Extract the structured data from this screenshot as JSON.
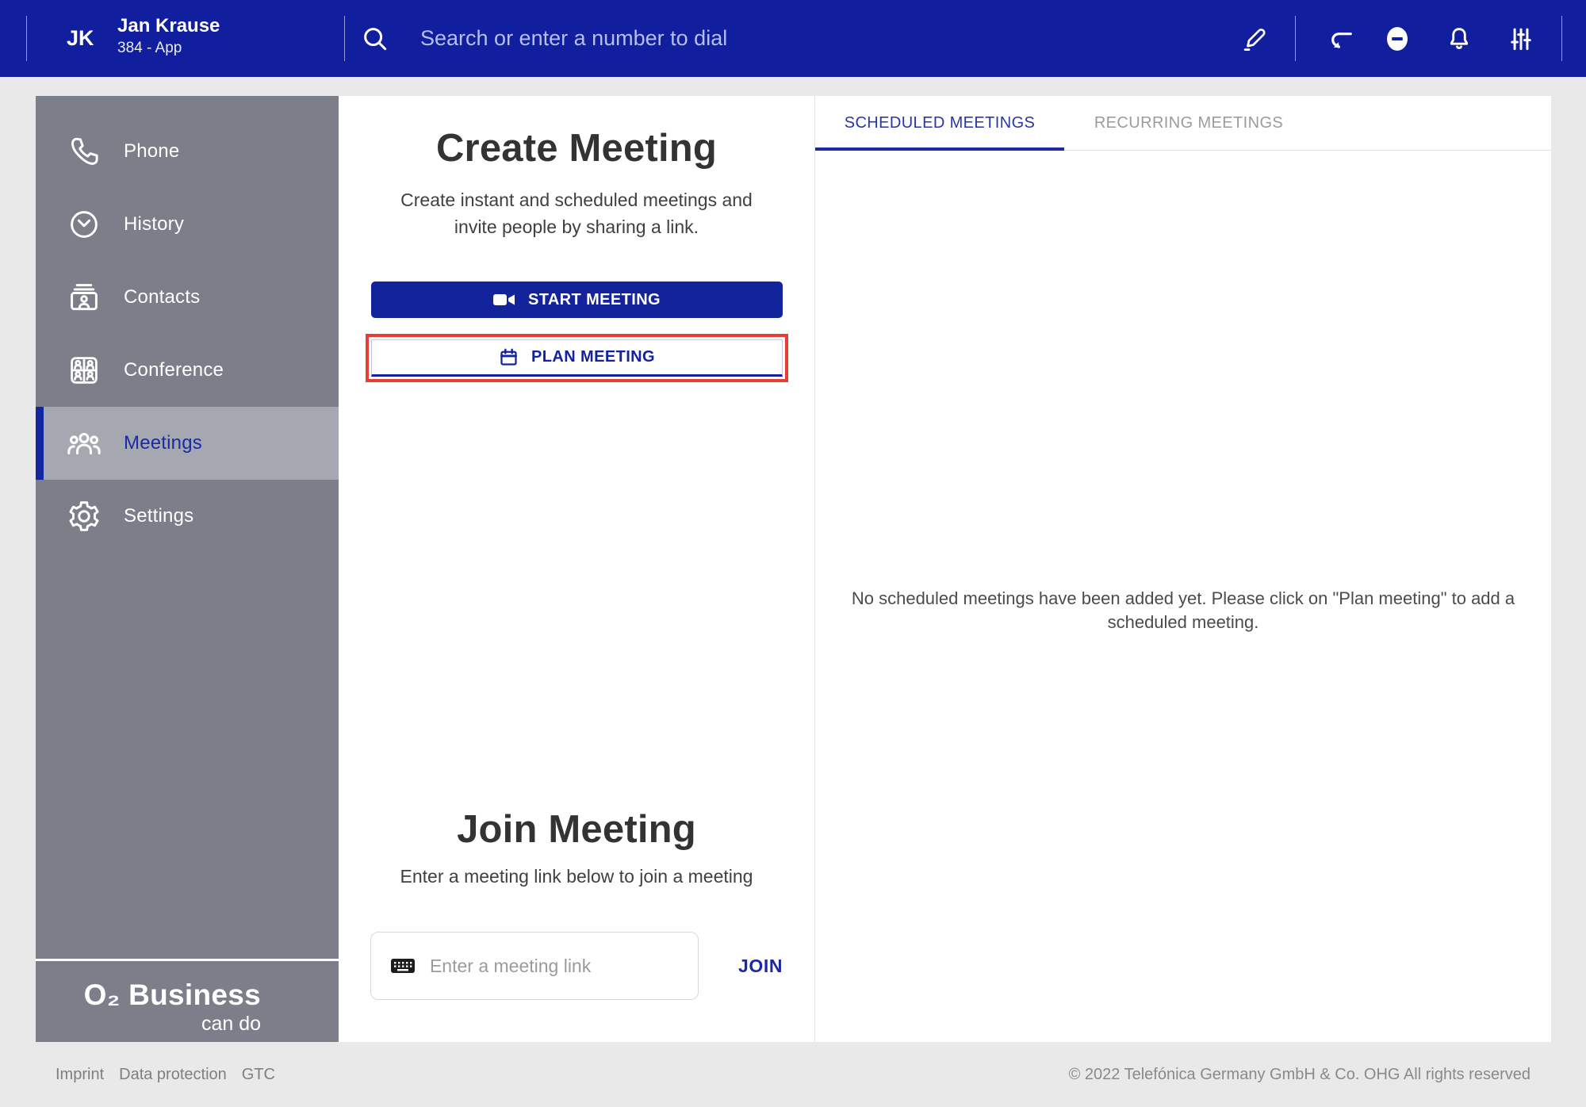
{
  "topbar": {
    "avatar_initials": "JK",
    "user_name": "Jan Krause",
    "user_extension": "384 - App",
    "search_placeholder": "Search or enter a number to dial",
    "icons": [
      "search-icon",
      "pencil-icon",
      "call-pull-icon",
      "do-not-disturb-icon",
      "bell-icon",
      "sliders-icon"
    ]
  },
  "sidebar": {
    "items": [
      {
        "label": "Phone",
        "icon": "phone-icon",
        "active": false
      },
      {
        "label": "History",
        "icon": "history-icon",
        "active": false
      },
      {
        "label": "Contacts",
        "icon": "contacts-icon",
        "active": false
      },
      {
        "label": "Conference",
        "icon": "conference-icon",
        "active": false
      },
      {
        "label": "Meetings",
        "icon": "meetings-icon",
        "active": true
      },
      {
        "label": "Settings",
        "icon": "settings-icon",
        "active": false
      }
    ],
    "logo_main": "O₂ Business",
    "logo_sub": "can do"
  },
  "create_meeting": {
    "title": "Create Meeting",
    "description": "Create instant and scheduled meetings and invite people by sharing a link.",
    "start_button": "START MEETING",
    "plan_button": "PLAN MEETING"
  },
  "join_meeting": {
    "title": "Join Meeting",
    "description": "Enter a meeting link below to join a meeting",
    "input_placeholder": "Enter a meeting link",
    "join_button": "JOIN"
  },
  "meetings_panel": {
    "tabs": [
      {
        "label": "SCHEDULED MEETINGS",
        "active": true
      },
      {
        "label": "RECURRING MEETINGS",
        "active": false
      }
    ],
    "empty_message": "No scheduled meetings have been added yet. Please click on \"Plan meeting\" to add a scheduled meeting."
  },
  "footer": {
    "links": [
      "Imprint",
      "Data protection",
      "GTC"
    ],
    "copyright": "© 2022 Telefónica Germany GmbH & Co. OHG All rights reserved"
  },
  "colors": {
    "brand_blue": "#111f9e",
    "button_blue": "#13239c",
    "accent_blue": "#1b2aa0",
    "highlight_red": "#ea3c34",
    "sidebar_gray": "#7c7e8a",
    "sidebar_active_gray": "#a5a7b1",
    "page_background": "#e9e9e9"
  }
}
